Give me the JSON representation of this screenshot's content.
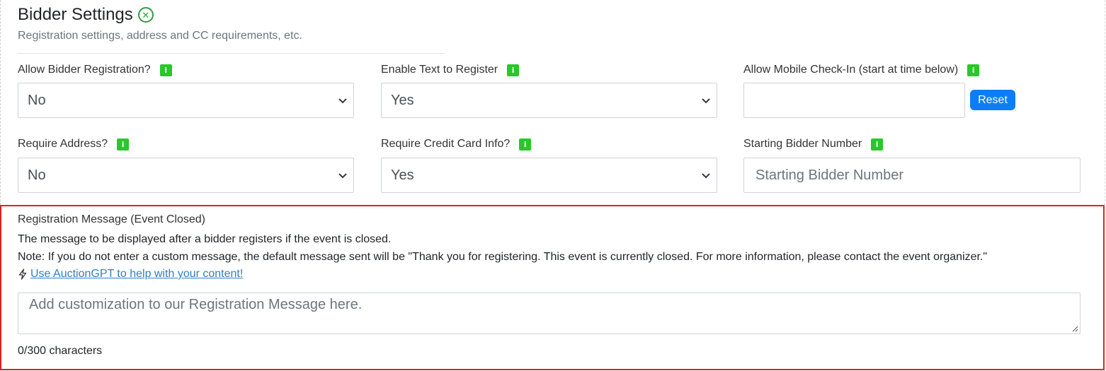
{
  "header": {
    "title": "Bidder Settings",
    "subtitle": "Registration settings, address and CC requirements, etc.",
    "status_icon": "close-circle-icon",
    "status_color": "#2e9e3e"
  },
  "fields": {
    "allow_registration": {
      "label": "Allow Bidder Registration?",
      "value": "No"
    },
    "enable_text": {
      "label": "Enable Text to Register",
      "value": "Yes"
    },
    "mobile_checkin": {
      "label": "Allow Mobile Check-In (start at time below)",
      "value": "",
      "reset_label": "Reset"
    },
    "require_address": {
      "label": "Require Address?",
      "value": "No"
    },
    "require_cc": {
      "label": "Require Credit Card Info?",
      "value": "Yes"
    },
    "starting_number": {
      "label": "Starting Bidder Number",
      "placeholder": "Starting Bidder Number",
      "value": ""
    }
  },
  "info_icon": {
    "name": "info-icon",
    "color": "#28c828",
    "glyph": "i"
  },
  "registration_message": {
    "label": "Registration Message (Event Closed)",
    "description": "The message to be displayed after a bidder registers if the event is closed.",
    "note": "Note: If you do not enter a custom message, the default message sent will be \"Thank you for registering. This event is currently closed. For more information, please contact the event organizer.\"",
    "ai_link": "Use AuctionGPT to help with your content!",
    "ai_icon": "lightning-bolt-icon",
    "placeholder": "Add customization to our Registration Message here.",
    "value": "",
    "char_count": "0/300 characters",
    "highlight_color": "#e02020"
  },
  "colors": {
    "accent": "#0d7df6",
    "link": "#2f7fc4"
  }
}
